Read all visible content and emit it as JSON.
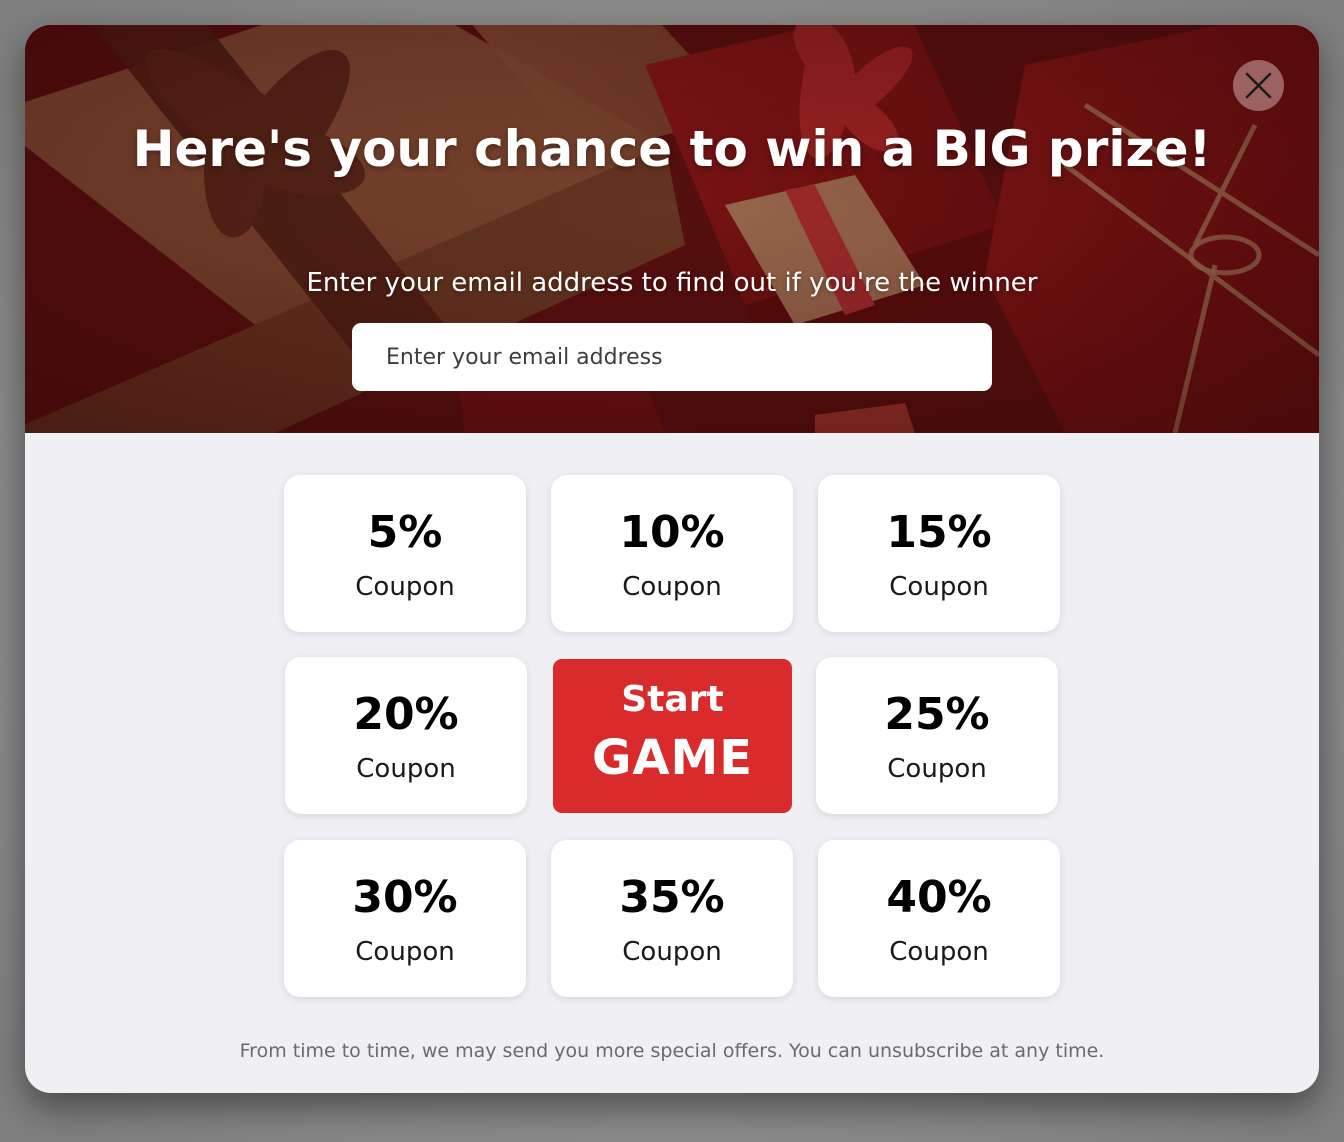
{
  "popup": {
    "headline": "Here's your chance to win a BIG prize!",
    "subheadline": "Enter your email address to find out if you're the winner",
    "email_placeholder": "Enter your email address",
    "close_icon": "close-icon",
    "tiles": [
      {
        "percent": "5%",
        "label": "Coupon"
      },
      {
        "percent": "10%",
        "label": "Coupon"
      },
      {
        "percent": "15%",
        "label": "Coupon"
      },
      {
        "percent": "20%",
        "label": "Coupon"
      },
      {
        "percent": "25%",
        "label": "Coupon"
      },
      {
        "percent": "30%",
        "label": "Coupon"
      },
      {
        "percent": "35%",
        "label": "Coupon"
      },
      {
        "percent": "40%",
        "label": "Coupon"
      }
    ],
    "start_button": {
      "line1": "Start",
      "line2": "GAME"
    },
    "disclaimer": "From time to time, we may send you more special offers. You can unsubscribe at any time."
  },
  "colors": {
    "accent": "#d92b2b",
    "panel_background": "#efeff4",
    "hero_tint": "#7a1818"
  }
}
